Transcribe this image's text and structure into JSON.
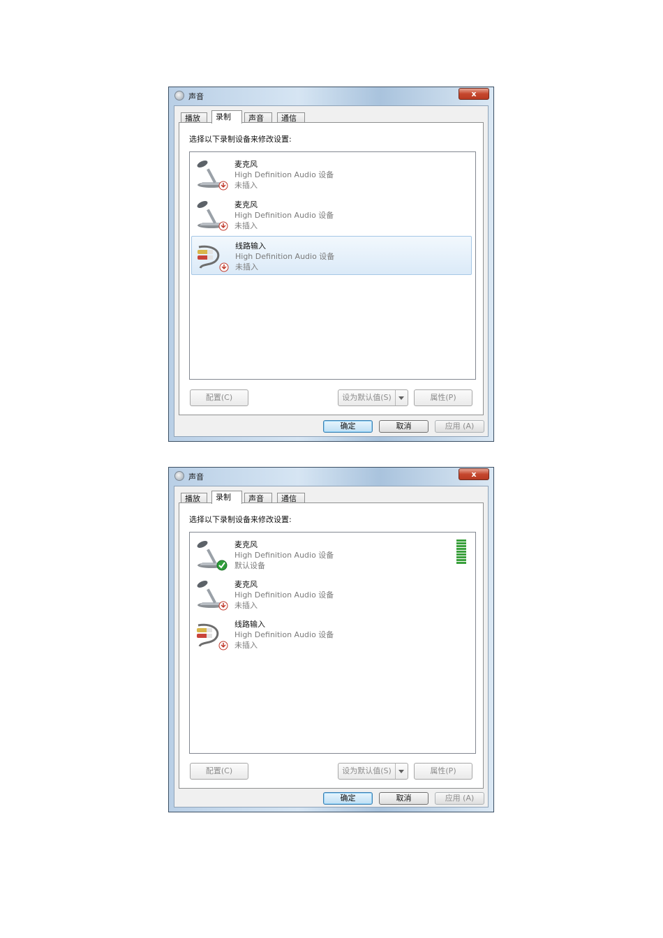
{
  "dialogs": [
    {
      "title": "声音",
      "close": "x",
      "tabs": [
        "播放",
        "录制",
        "声音",
        "通信"
      ],
      "instruction": "选择以下录制设备来修改设置:",
      "devices": [
        {
          "name": "麦克风",
          "desc": "High Definition Audio 设备",
          "state": "未插入",
          "icon": "microphone-icon",
          "status_icon": "unplugged-icon"
        },
        {
          "name": "麦克风",
          "desc": "High Definition Audio 设备",
          "state": "未插入",
          "icon": "microphone-icon",
          "status_icon": "unplugged-icon"
        },
        {
          "name": "线路输入",
          "desc": "High Definition Audio 设备",
          "state": "未插入",
          "icon": "line-in-cable-icon",
          "status_icon": "unplugged-icon",
          "selected": true
        }
      ],
      "buttons": {
        "configure": "配置(C)",
        "set_default": "设为默认值(S)",
        "properties": "属性(P)"
      },
      "footer": {
        "ok": "确定",
        "cancel": "取消",
        "apply": "应用 (A)"
      }
    },
    {
      "title": "声音",
      "close": "x",
      "tabs": [
        "播放",
        "录制",
        "声音",
        "通信"
      ],
      "instruction": "选择以下录制设备来修改设置:",
      "devices": [
        {
          "name": "麦克风",
          "desc": "High Definition Audio 设备",
          "state": "默认设备",
          "icon": "microphone-icon",
          "status_icon": "default-check-icon",
          "level": 0.9
        },
        {
          "name": "麦克风",
          "desc": "High Definition Audio 设备",
          "state": "未插入",
          "icon": "microphone-icon",
          "status_icon": "unplugged-icon"
        },
        {
          "name": "线路输入",
          "desc": "High Definition Audio 设备",
          "state": "未插入",
          "icon": "line-in-cable-icon",
          "status_icon": "unplugged-icon"
        }
      ],
      "buttons": {
        "configure": "配置(C)",
        "set_default": "设为默认值(S)",
        "properties": "属性(P)"
      },
      "footer": {
        "ok": "确定",
        "cancel": "取消",
        "apply": "应用 (A)"
      }
    }
  ],
  "colors": {
    "selection": "#dbeaf8",
    "unplugged": "#c0392b",
    "default_check": "#2e9e3a",
    "meter": "#3aa03c"
  }
}
